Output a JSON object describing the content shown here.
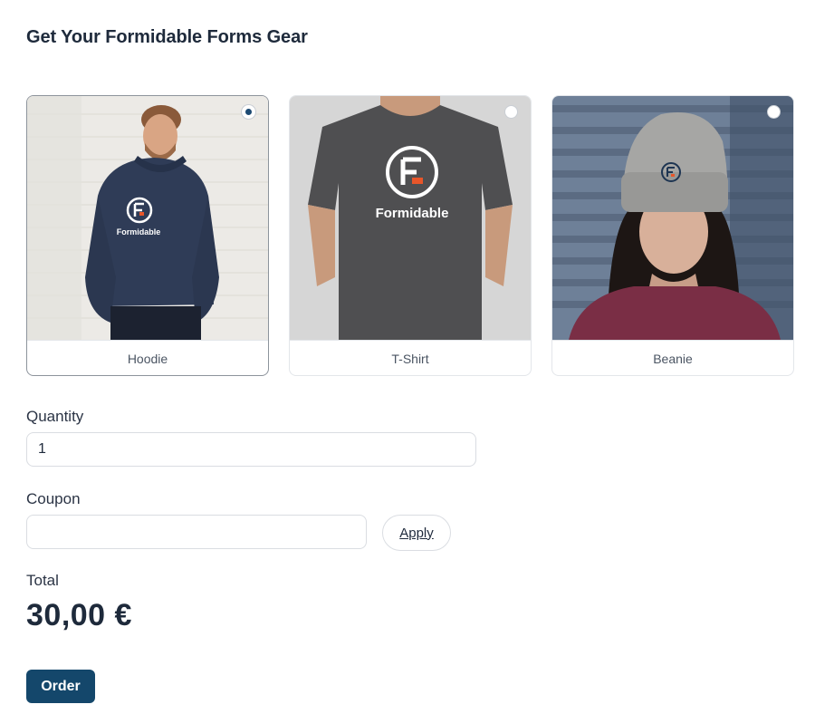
{
  "form": {
    "title": "Get Your Formidable Forms Gear",
    "products": [
      {
        "label": "Hoodie",
        "selected": true,
        "brand_text": "Formidable"
      },
      {
        "label": "T-Shirt",
        "selected": false,
        "brand_text": "Formidable"
      },
      {
        "label": "Beanie",
        "selected": false
      }
    ],
    "quantity": {
      "label": "Quantity",
      "value": "1"
    },
    "coupon": {
      "label": "Coupon",
      "value": "",
      "apply_label": "Apply"
    },
    "total": {
      "label": "Total",
      "value": "30,00 €"
    },
    "order_label": "Order"
  },
  "colors": {
    "accent": "#14476b",
    "radio_checked": "#1c4a73",
    "logo_orange": "#e8562a"
  }
}
